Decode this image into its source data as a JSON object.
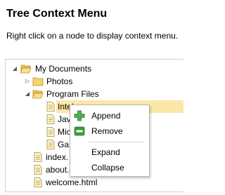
{
  "page": {
    "title": "Tree Context Menu",
    "subtitle": "Right click on a node to display context menu."
  },
  "tree": {
    "nodes": [
      {
        "label": "My Documents",
        "type": "folder",
        "expanded": true
      },
      {
        "label": "Photos",
        "type": "folder",
        "expanded": false
      },
      {
        "label": "Program Files",
        "type": "folder",
        "expanded": true
      },
      {
        "label": "Intel",
        "type": "file",
        "selected": true
      },
      {
        "label": "Java",
        "type": "file"
      },
      {
        "label": "Microsoft Office",
        "type": "file"
      },
      {
        "label": "Games",
        "type": "file"
      },
      {
        "label": "index.html",
        "type": "file"
      },
      {
        "label": "about.html",
        "type": "file"
      },
      {
        "label": "welcome.html",
        "type": "file"
      }
    ],
    "visible_text": {
      "intel": "Intel",
      "java": "Jav",
      "microsoft": "Mic",
      "games": "Ga",
      "index": "index.",
      "about": "about."
    }
  },
  "context_menu": {
    "items": [
      {
        "label": "Append",
        "icon": "plus-icon",
        "color": "#3a9b3a"
      },
      {
        "label": "Remove",
        "icon": "minus-icon",
        "color": "#3a9b3a"
      },
      {
        "label": "Expand",
        "icon": ""
      },
      {
        "label": "Collapse",
        "icon": ""
      }
    ]
  },
  "colors": {
    "selection": "#fbe7a8",
    "folder": "#f5d46b",
    "accent_green": "#3a9b3a"
  }
}
